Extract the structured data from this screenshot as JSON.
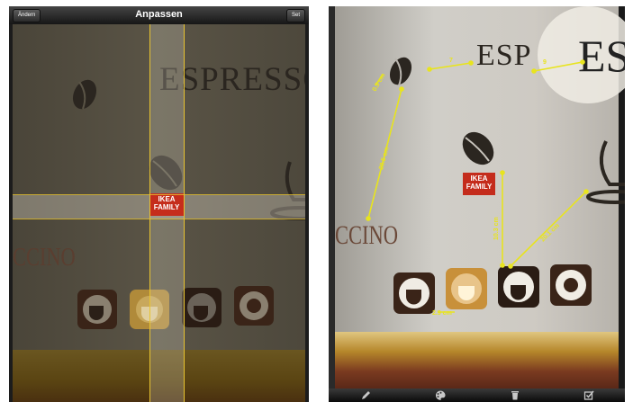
{
  "left_screen": {
    "nav": {
      "title": "Anpassen",
      "left_button": "Ändern",
      "right_button": "Set"
    },
    "photo": {
      "wall_text_top": "ESPRESSO",
      "wall_text_side": "CCINO",
      "badge_line1": "IKEA",
      "badge_line2": "FAMILY"
    }
  },
  "right_screen": {
    "photo": {
      "wall_text_top": "ESP",
      "magnifier_text": "ES",
      "wall_text_side": "CCINO",
      "badge_line1": "IKEA",
      "badge_line2": "FAMILY"
    },
    "measurements": {
      "m_top_left": "7",
      "m_magnifier": "9",
      "m_bean_small": "0.5 cm",
      "m_long_diag": "20.5 cm",
      "m_vertical": "10.3 cm",
      "m_diag_right": "20.1 cm",
      "m_bottom": "2.9 cm"
    },
    "toolbar": [
      "pencil-icon",
      "palette-icon",
      "trash-icon",
      "checkbox-icon"
    ]
  },
  "colors": {
    "measure_yellow": "#e8e41e",
    "guide_yellow": "#e8c431",
    "ikea_red": "#c52d1c",
    "nav_bar": "#2a2a2a"
  }
}
